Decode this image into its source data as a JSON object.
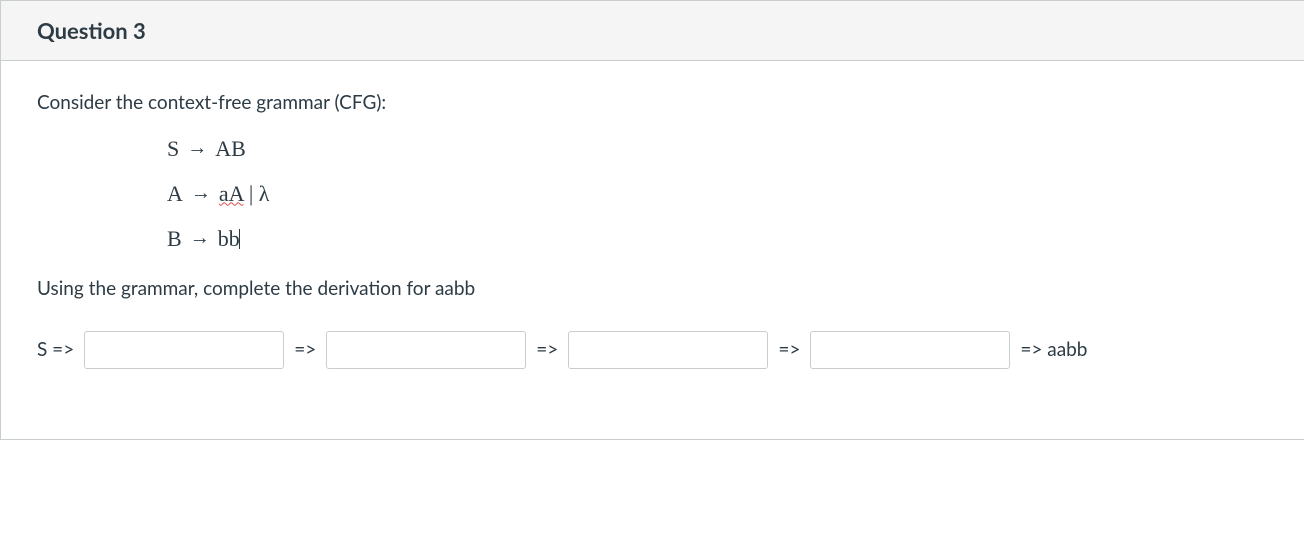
{
  "header": {
    "title": "Question 3"
  },
  "body": {
    "intro": "Consider the context-free grammar (CFG):",
    "rules": {
      "r1_left": "S",
      "r1_right": "AB",
      "r2_left": "A",
      "r2_right_a": "aA",
      "r2_right_b_sep": " | ",
      "r2_right_b": "λ",
      "r3_left": "B",
      "r3_right": "bb"
    },
    "instruction": "Using the grammar, complete the derivation for aabb",
    "derivation": {
      "start": "S =>",
      "sep": "=>",
      "final": "=> aabb",
      "input1": "",
      "input2": "",
      "input3": "",
      "input4": ""
    }
  }
}
